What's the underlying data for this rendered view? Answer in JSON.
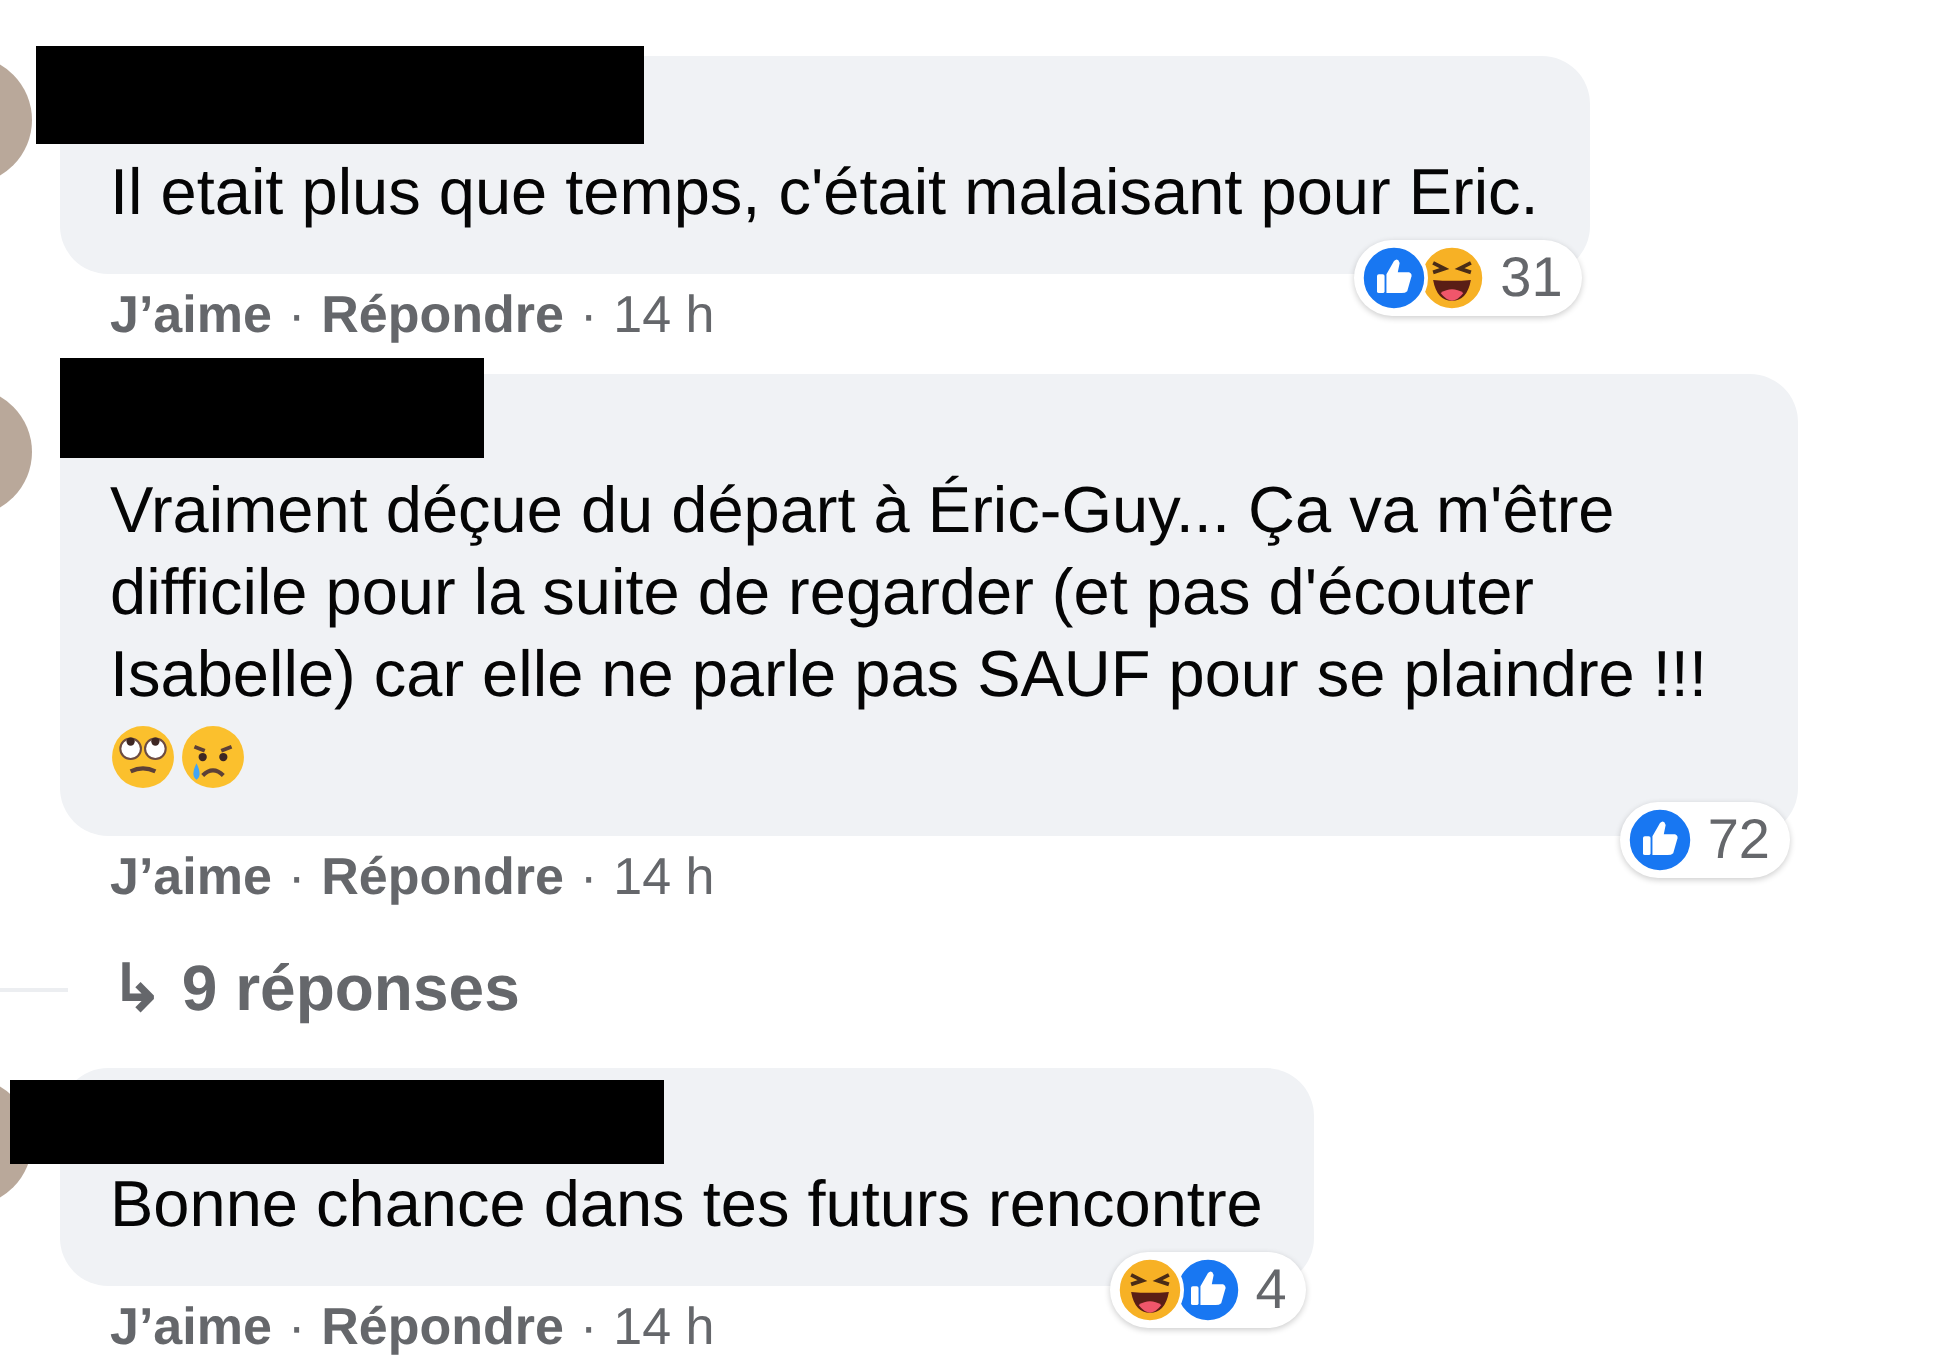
{
  "comments": [
    {
      "name_redacted": true,
      "text": "Il etait plus que temps, c'était malaisant pour Eric.",
      "reactions": [
        {
          "kind": "like"
        },
        {
          "kind": "haha"
        }
      ],
      "reaction_count": "31",
      "actions": [
        "J’aime",
        "·",
        "Répondre",
        "·",
        "14 h"
      ]
    },
    {
      "name_redacted": true,
      "text": "Vraiment déçue du départ à Éric-Guy... Ça va m'être difficile pour la suite de regarder (et pas d'écouter Isabelle) car elle ne parle pas SAUF pour se plaindre !!!",
      "emojis": [
        {
          "kind": "eye-roll"
        },
        {
          "kind": "crying"
        }
      ],
      "reactions": [
        {
          "kind": "like"
        }
      ],
      "reaction_count": "72",
      "actions": [
        "J’aime",
        "·",
        "Répondre",
        "·",
        "14 h"
      ],
      "replies": {
        "icon": "↳",
        "label": "9 réponses"
      }
    },
    {
      "name_redacted": true,
      "text": "Bonne chance dans tes futurs rencontre",
      "reactions": [
        {
          "kind": "haha"
        },
        {
          "kind": "like"
        }
      ],
      "reaction_count": "4",
      "actions": [
        "J’aime",
        "·",
        "Répondre",
        "·",
        "14 h"
      ]
    }
  ]
}
